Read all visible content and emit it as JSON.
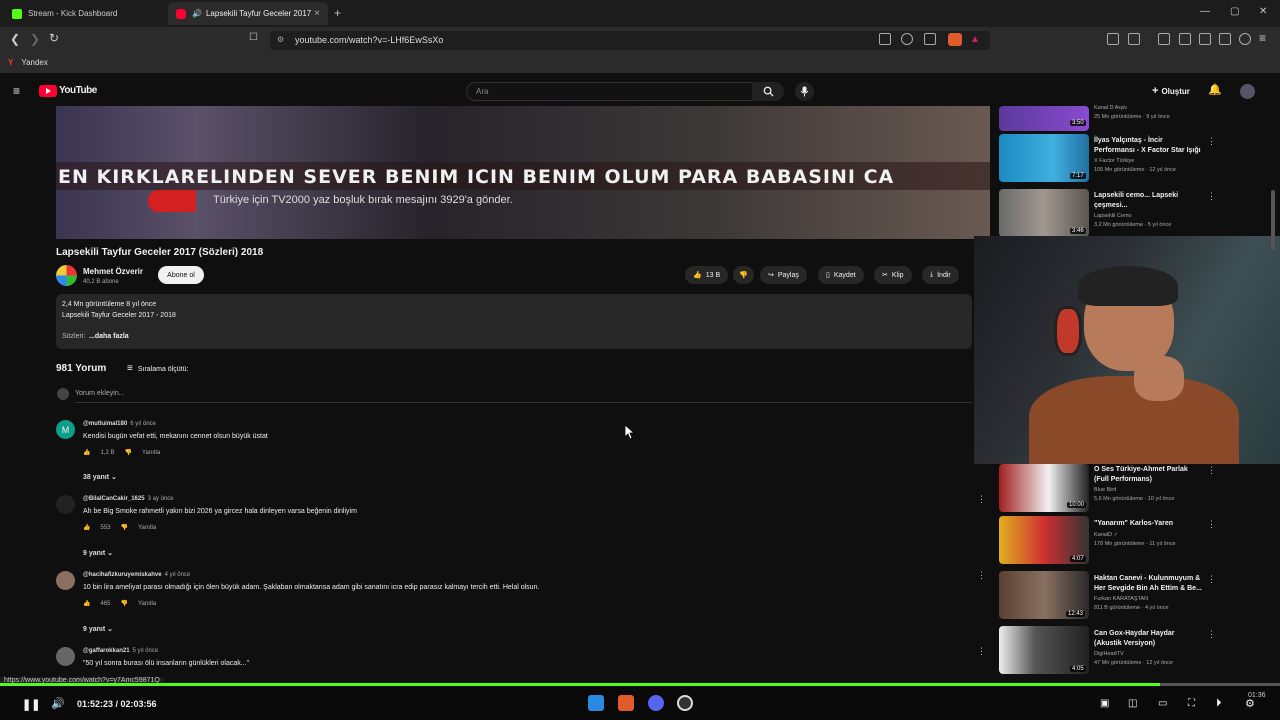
{
  "browser": {
    "tabs": [
      {
        "label": "Stream - Kick Dashboard"
      },
      {
        "label": "Lapsekili Tayfur Geceler 2017"
      }
    ],
    "url": "youtube.com/watch?v=-LHf6EwSsXo",
    "bookmark": "Yandex",
    "status_url": "https://www.youtube.com/watch?v=y7Amc59871Q"
  },
  "youtube": {
    "logo": "YouTube",
    "search_placeholder": "Ara",
    "create_label": "Oluştur"
  },
  "video": {
    "caption": "EN KIRKLARELINDEN SEVER BENIM ICIN BENIM OLUM PARA BABASINI CA",
    "subcaption": "Türkiye için TV2000 yaz boşluk bırak mesajını 3929'a gönder.",
    "title": "Lapsekili Tayfur Geceler 2017 (Sözleri) 2018",
    "channel": "Mehmet Özverir",
    "subscribers": "40,2 B abone",
    "subscribe_label": "Abone ol",
    "likes": "13 B",
    "actions": {
      "share": "Paylaş",
      "save": "Kaydet",
      "clip": "Klip",
      "download": "İndir"
    }
  },
  "description": {
    "stats": "2,4 Mn görüntüleme  8 yıl önce",
    "line1": "Lapsekili Tayfur Geceler 2017 - 2018",
    "line2": "Sözleri:",
    "more": "...daha fazla"
  },
  "comments_header": {
    "count": "981 Yorum",
    "sort_label": "Sıralama ölçütü:",
    "add_placeholder": "Yorum ekleyin..."
  },
  "comments": [
    {
      "author": "@mutluimal180",
      "time": "6 yıl önce",
      "text": "Kendisi bugün vefat etti, mekanını cennet olsun büyük üstat",
      "likes": "1,2 B",
      "reply": "Yanıtla",
      "replies": "38 yanıt",
      "avatar_letter": "M"
    },
    {
      "author": "@BilalCanCakir_1625",
      "time": "3 ay önce",
      "text": "Ah be Big Smoke rahmetli yakın bizi 2026 ya gircez hala dinleyen varsa beğenin dinliyim",
      "likes": "553",
      "reply": "Yanıtla",
      "replies": "9 yanıt"
    },
    {
      "author": "@hacihafizkuruyemiskahve",
      "time": "4 yıl önce",
      "text": "10 bin lira ameliyat parası olmadığı için ölen büyük adam. Şaklaban olmaktansa adam gibi sanatını icra edip parasız kalmayı tercih etti. Helal olsun.",
      "likes": "465",
      "reply": "Yanıtla",
      "replies": "9 yanıt"
    },
    {
      "author": "@gaffarokkan21",
      "time": "5 yıl önce",
      "text": "\"50 yıl sonra burası ölü insanların günlükleri olacak...\""
    }
  ],
  "sidebar": [
    {
      "title": "Kanal D Arşiv",
      "meta": "25 Mn görüntüleme · 9 yıl önce",
      "duration": "3:50"
    },
    {
      "title": "İlyas Yalçıntaş - İncir Performansı - X Factor Star Işığı",
      "meta": "X Factor Türkiye\n105 Mn görüntüleme · 12 yıl önce",
      "duration": "7:17"
    },
    {
      "title": "Lapsekili cemo... Lapseki çeşmesi...",
      "meta": "Lapsekili Cemo\n3,2 Mn görüntüleme · 5 yıl önce",
      "duration": "3:46"
    },
    {
      "title": "O Ses Türkiye-Ahmet Parlak (Full Performans)",
      "meta": "Blue Bird\n5,6 Mn görüntüleme · 10 yıl önce",
      "duration": "10:00"
    },
    {
      "title": "\"Yanarım\" Karlos-Yaren",
      "meta": "KanalD ✓\n178 Mn görüntüleme · 11 yıl önce",
      "duration": "4:07"
    },
    {
      "title": "Haktan Canevi - Kulunmuyum & Her Sevgide Bin Ah Ettim & Be...",
      "meta": "Furkan KARATAŞTAN\n811 B görüntüleme · 4 yıl önce",
      "duration": "12:43"
    },
    {
      "title": "Can Gox-Haydar Haydar (Akustik Versiyon)",
      "meta": "DigiHeadTV\n47 Mn görüntüleme · 12 yıl önce",
      "duration": "4:05"
    }
  ],
  "player": {
    "time": "01:52:23 / 02:03:56",
    "progress": 0.906,
    "clock": "01:36"
  },
  "colors": {
    "kick_green": "#53fc18",
    "youtube_red": "#ff0033"
  }
}
